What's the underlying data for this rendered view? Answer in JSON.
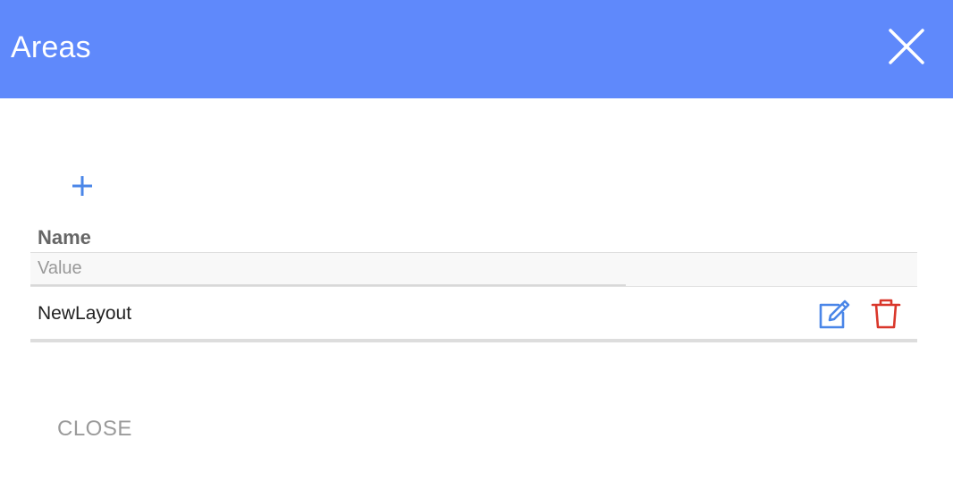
{
  "dialog": {
    "title": "Areas",
    "header_color": "#5f89fb",
    "close_icon": "close-icon"
  },
  "toolbar": {
    "add_icon": "plus-icon",
    "add_color": "#4a86e8"
  },
  "table": {
    "columns": [
      {
        "label": "Name"
      }
    ],
    "filter": {
      "placeholder": "Value",
      "value": ""
    },
    "rows": [
      {
        "name": "NewLayout",
        "actions": [
          {
            "icon": "edit-icon",
            "color": "#4a86e8"
          },
          {
            "icon": "trash-icon",
            "color": "#d9372b"
          }
        ]
      }
    ]
  },
  "footer": {
    "close_label": "CLOSE"
  }
}
